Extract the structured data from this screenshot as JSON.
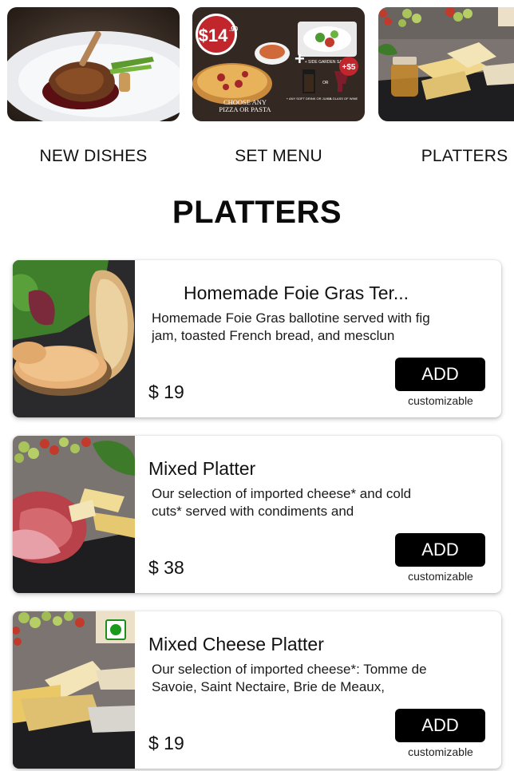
{
  "categories": [
    {
      "label": "NEW DISHES",
      "icon": "duck-confit-photo"
    },
    {
      "label": "SET MENU",
      "icon": "set-menu-promo-photo",
      "promo": {
        "price": "$14",
        "cents": ".90",
        "addon": "+$5",
        "caption_line1": "CHOOSE ANY",
        "caption_line2": "PIZZA OR PASTA",
        "side_label": "+ SIDE GARDEN SALAD",
        "drink_label": "+ ANY SOFT DRINK OR JUICE",
        "or_label": "OR",
        "wine_label": "+ A GLASS OF WINE"
      }
    },
    {
      "label": "PLATTERS",
      "icon": "cheese-platter-photo"
    }
  ],
  "section": {
    "title": "PLATTERS"
  },
  "items": [
    {
      "title": "Homemade Foie Gras Ter...",
      "description": "Homemade Foie Gras ballotine served with fig jam, toasted French bread, and mesclun",
      "price": "$ 19",
      "button": "ADD",
      "note": "customizable",
      "image": "foie-gras-photo"
    },
    {
      "title": "Mixed Platter",
      "description": "Our selection of imported cheese* and cold cuts* served with condiments and",
      "price": "$ 38",
      "button": "ADD",
      "note": "customizable",
      "image": "mixed-platter-photo"
    },
    {
      "title": "Mixed Cheese Platter",
      "description": "Our selection of imported cheese*: Tomme de Savoie, Saint Nectaire, Brie de Meaux,",
      "price": "$ 19",
      "button": "ADD",
      "note": "customizable",
      "image": "cheese-platter-photo",
      "veg": true
    }
  ],
  "colors": {
    "button": "#000000",
    "veg": "#1a9a1a",
    "promo_red": "#c0262b"
  }
}
